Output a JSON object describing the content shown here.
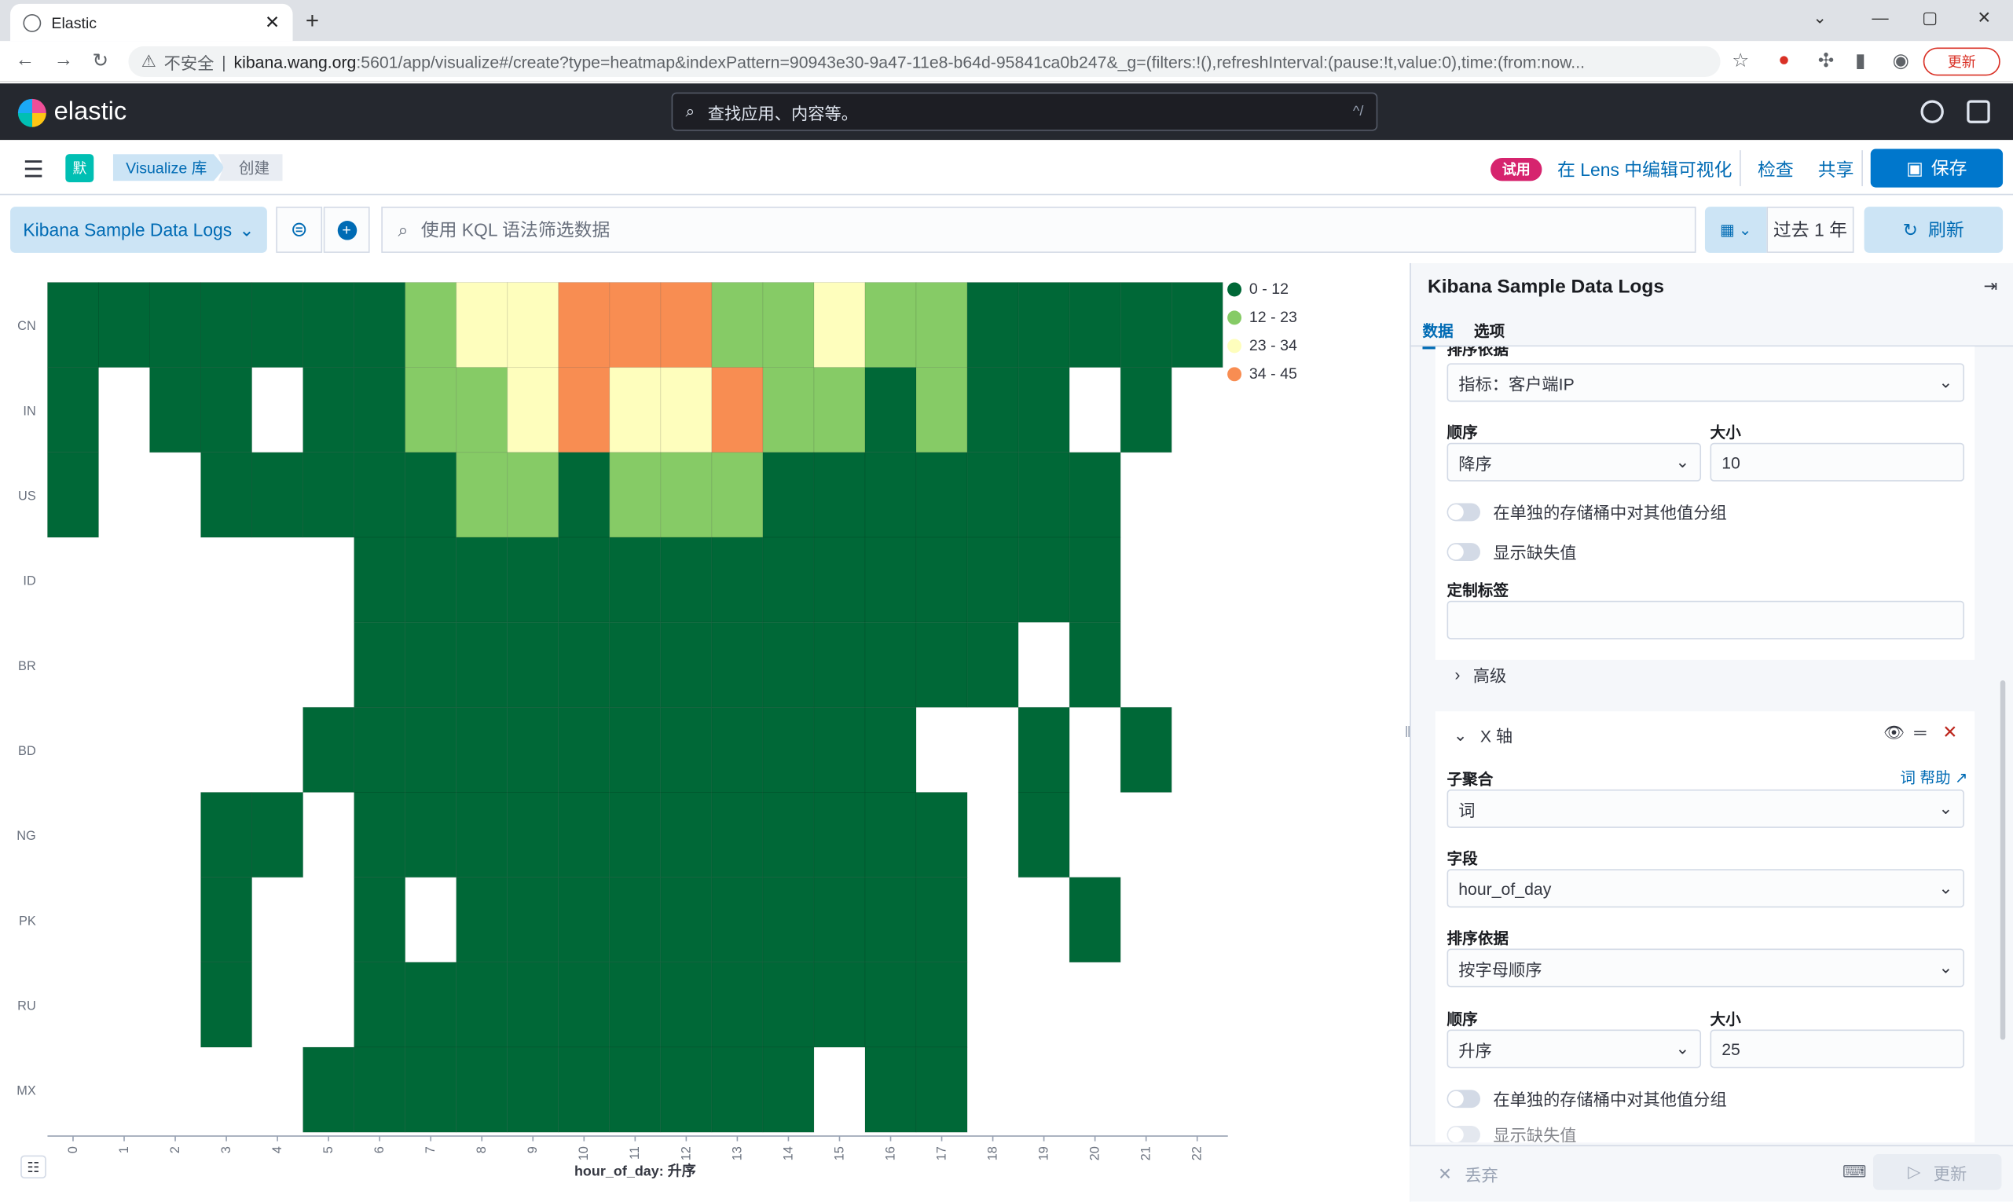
{
  "browser": {
    "tab_title": "Elastic",
    "security_label": "不安全",
    "url_host": "kibana.wang.org",
    "url_path": ":5601/app/visualize#/create?type=heatmap&indexPattern=90943e30-9a47-11e8-b64d-95841ca0b247&_g=(filters:!(),refreshInterval:(pause:!t,value:0),time:(from:now...",
    "update_label": "更新"
  },
  "header": {
    "logo_text": "elastic",
    "search_placeholder": "查找应用、内容等。",
    "search_shortcut": "^/"
  },
  "breadcrumbs": {
    "space_initial": "默",
    "items": [
      "Visualize 库",
      "创建"
    ]
  },
  "toolbar": {
    "trial_badge": "试用",
    "lens_link": "在 Lens 中编辑可视化",
    "inspect": "检查",
    "share": "共享",
    "save": "保存"
  },
  "query": {
    "index_pattern": "Kibana Sample Data Logs",
    "kql_placeholder": "使用 KQL 语法筛选数据",
    "date_range": "过去 1 年",
    "refresh": "刷新"
  },
  "chart_data": {
    "type": "heatmap",
    "xlabel": "hour_of_day: 升序",
    "x": [
      "0",
      "1",
      "2",
      "3",
      "4",
      "5",
      "6",
      "7",
      "8",
      "9",
      "10",
      "11",
      "12",
      "13",
      "14",
      "15",
      "16",
      "17",
      "18",
      "19",
      "20",
      "21",
      "22"
    ],
    "y": [
      "CN",
      "IN",
      "US",
      "ID",
      "BR",
      "BD",
      "NG",
      "PK",
      "RU",
      "MX"
    ],
    "legend": [
      {
        "label": "0 - 12",
        "color": "#006837"
      },
      {
        "label": "12 - 23",
        "color": "#86cb66"
      },
      {
        "label": "23 - 34",
        "color": "#fefebd"
      },
      {
        "label": "34 - 45",
        "color": "#f88d52"
      }
    ],
    "bins": [
      [
        0,
        0,
        0,
        0,
        0,
        0,
        0,
        1,
        2,
        2,
        3,
        3,
        3,
        1,
        1,
        2,
        1,
        1,
        0,
        0,
        0,
        0,
        0
      ],
      [
        0,
        -1,
        0,
        0,
        -1,
        0,
        0,
        1,
        1,
        2,
        3,
        2,
        2,
        3,
        1,
        1,
        0,
        1,
        0,
        0,
        -1,
        0,
        -1
      ],
      [
        0,
        -1,
        -1,
        0,
        0,
        0,
        0,
        0,
        1,
        1,
        0,
        1,
        1,
        1,
        0,
        0,
        0,
        0,
        0,
        0,
        0,
        -1,
        -1
      ],
      [
        -1,
        -1,
        -1,
        -1,
        -1,
        -1,
        0,
        0,
        0,
        0,
        0,
        0,
        0,
        0,
        0,
        0,
        0,
        0,
        0,
        0,
        0,
        -1,
        -1
      ],
      [
        -1,
        -1,
        -1,
        -1,
        -1,
        -1,
        0,
        0,
        0,
        0,
        0,
        0,
        0,
        0,
        0,
        0,
        0,
        0,
        0,
        -1,
        0,
        -1,
        -1
      ],
      [
        -1,
        -1,
        -1,
        -1,
        -1,
        0,
        0,
        0,
        0,
        0,
        0,
        0,
        0,
        0,
        0,
        0,
        0,
        -1,
        -1,
        0,
        -1,
        0,
        -1
      ],
      [
        -1,
        -1,
        -1,
        0,
        0,
        -1,
        0,
        0,
        0,
        0,
        0,
        0,
        0,
        0,
        0,
        0,
        0,
        0,
        -1,
        0,
        -1,
        -1,
        -1
      ],
      [
        -1,
        -1,
        -1,
        0,
        -1,
        -1,
        0,
        -1,
        0,
        0,
        0,
        0,
        0,
        0,
        0,
        0,
        0,
        0,
        -1,
        -1,
        0,
        -1,
        -1
      ],
      [
        -1,
        -1,
        -1,
        0,
        -1,
        -1,
        0,
        0,
        0,
        0,
        0,
        0,
        0,
        0,
        0,
        0,
        0,
        0,
        -1,
        -1,
        -1,
        -1,
        -1
      ],
      [
        -1,
        -1,
        -1,
        -1,
        -1,
        0,
        0,
        0,
        0,
        0,
        0,
        0,
        0,
        0,
        0,
        -1,
        0,
        0,
        -1,
        -1,
        -1,
        -1,
        -1
      ]
    ]
  },
  "panel": {
    "title": "Kibana Sample Data Logs",
    "tabs": [
      "数据",
      "选项"
    ],
    "y_bucket": {
      "order_by_label": "排序依据",
      "order_by_value": "指标：客户端IP",
      "order_label": "顺序",
      "order_value": "降序",
      "size_label": "大小",
      "size_value": "10",
      "group_other": "在单独的存储桶中对其他值分组",
      "show_missing": "显示缺失值",
      "custom_label": "定制标签",
      "advanced": "高级"
    },
    "x_bucket": {
      "title": "X 轴",
      "sub_agg_label": "子聚合",
      "help_link": "词 帮助",
      "sub_agg_value": "词",
      "field_label": "字段",
      "field_value": "hour_of_day",
      "order_by_label": "排序依据",
      "order_by_value": "按字母顺序",
      "order_label": "顺序",
      "order_value": "升序",
      "size_label": "大小",
      "size_value": "25",
      "group_other": "在单独的存储桶中对其他值分组",
      "show_missing": "显示缺失值"
    },
    "footer": {
      "discard": "丢弃",
      "update": "更新"
    }
  }
}
